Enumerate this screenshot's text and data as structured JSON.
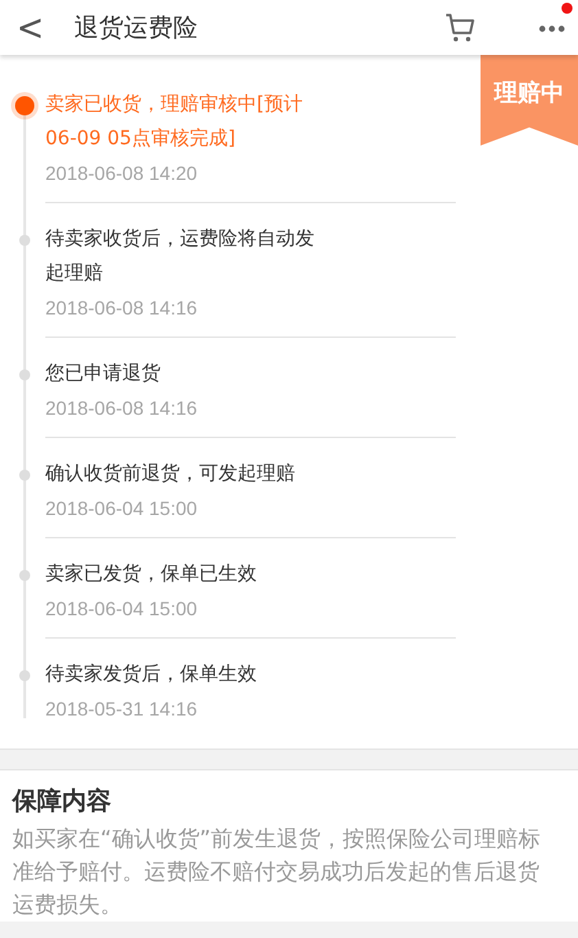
{
  "header": {
    "back": "<",
    "title": "退货运费险",
    "notification_dot": true
  },
  "status_badge": "理赔中",
  "timeline": [
    {
      "lines": [
        "卖家已收货，理赔审核中[预计",
        "06-09 05点审核完成]"
      ],
      "time": "2018-06-08 14:20",
      "current": true
    },
    {
      "lines": [
        "待卖家收货后，运费险将自动发",
        "起理赔"
      ],
      "time": "2018-06-08 14:16",
      "current": false
    },
    {
      "lines": [
        "您已申请退货"
      ],
      "time": "2018-06-08 14:16",
      "current": false
    },
    {
      "lines": [
        "确认收货前退货，可发起理赔"
      ],
      "time": "2018-06-04 15:00",
      "current": false
    },
    {
      "lines": [
        "卖家已发货，保单已生效"
      ],
      "time": "2018-06-04 15:00",
      "current": false
    },
    {
      "lines": [
        "待卖家发货后，保单生效"
      ],
      "time": "2018-05-31 14:16",
      "current": false
    }
  ],
  "coverage": {
    "title": "保障内容",
    "text": "如买家在“确认收货”前发生退货，按照保险公司理赔标准给予赔付。运费险不赔付交易成功后发起的售后退货运费损失。"
  }
}
